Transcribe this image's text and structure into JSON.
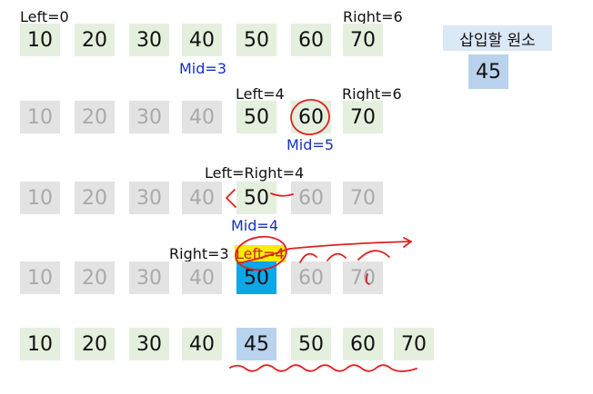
{
  "title": "삽입할 원소",
  "insert_value": "45",
  "rows": [
    {
      "cells": [
        {
          "v": "10",
          "s": "active"
        },
        {
          "v": "20",
          "s": "active"
        },
        {
          "v": "30",
          "s": "active"
        },
        {
          "v": "40",
          "s": "active"
        },
        {
          "v": "50",
          "s": "active"
        },
        {
          "v": "60",
          "s": "active"
        },
        {
          "v": "70",
          "s": "active"
        }
      ],
      "labels": {
        "left": "Left=0",
        "right": "Right=6",
        "mid": "Mid=3"
      }
    },
    {
      "cells": [
        {
          "v": "10",
          "s": "inactive"
        },
        {
          "v": "20",
          "s": "inactive"
        },
        {
          "v": "30",
          "s": "inactive"
        },
        {
          "v": "40",
          "s": "inactive"
        },
        {
          "v": "50",
          "s": "active"
        },
        {
          "v": "60",
          "s": "active"
        },
        {
          "v": "70",
          "s": "active"
        }
      ],
      "labels": {
        "left": "Left=4",
        "right": "Right=6",
        "mid": "Mid=5"
      }
    },
    {
      "cells": [
        {
          "v": "10",
          "s": "inactive"
        },
        {
          "v": "20",
          "s": "inactive"
        },
        {
          "v": "30",
          "s": "inactive"
        },
        {
          "v": "40",
          "s": "inactive"
        },
        {
          "v": "50",
          "s": "active"
        },
        {
          "v": "60",
          "s": "inactive"
        },
        {
          "v": "70",
          "s": "inactive"
        }
      ],
      "labels": {
        "leftright": "Left=Right=4",
        "mid": "Mid=4"
      }
    },
    {
      "cells": [
        {
          "v": "10",
          "s": "inactive"
        },
        {
          "v": "20",
          "s": "inactive"
        },
        {
          "v": "30",
          "s": "inactive"
        },
        {
          "v": "40",
          "s": "inactive"
        },
        {
          "v": "50",
          "s": "blue"
        },
        {
          "v": "60",
          "s": "inactive"
        },
        {
          "v": "70",
          "s": "inactive"
        }
      ],
      "labels": {
        "right": "Right=3",
        "left": "Left=4"
      }
    },
    {
      "cells": [
        {
          "v": "10",
          "s": "active"
        },
        {
          "v": "20",
          "s": "active"
        },
        {
          "v": "30",
          "s": "active"
        },
        {
          "v": "40",
          "s": "active"
        },
        {
          "v": "45",
          "s": "insert"
        },
        {
          "v": "50",
          "s": "active"
        },
        {
          "v": "60",
          "s": "active"
        },
        {
          "v": "70",
          "s": "active"
        }
      ]
    }
  ],
  "colors": {
    "active": "#e5efdd",
    "inactive": "#e3e3e3",
    "highlight_blue": "#0aa8e8",
    "insert": "#b9d3ee",
    "mid_text": "#1530c6",
    "ink_red": "#e02020",
    "marker_yellow": "#f6ee00"
  }
}
